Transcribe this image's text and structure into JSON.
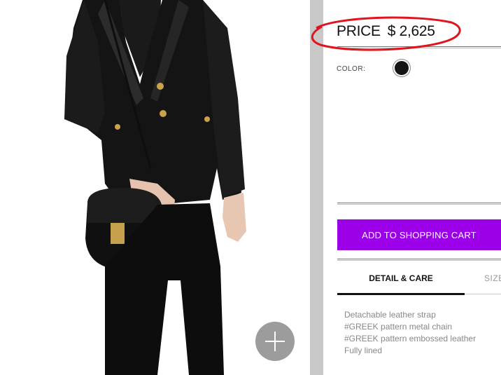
{
  "product": {
    "price_label": "PRICE",
    "price_value": "$ 2,625",
    "color_label": "COLOR:",
    "color_swatch": "#151515"
  },
  "actions": {
    "add_to_cart": "ADD TO SHOPPING CART"
  },
  "tabs": [
    {
      "label": "DETAIL & CARE",
      "active": true
    },
    {
      "label": "SIZE",
      "active": false
    }
  ],
  "details": [
    "Detachable leather strap",
    "#GREEK pattern metal chain",
    "#GREEK pattern embossed leather",
    "Fully lined"
  ],
  "icons": {
    "zoom": "plus-icon"
  },
  "colors": {
    "accent": "#9b00e8",
    "annotation": "#e0141e"
  }
}
